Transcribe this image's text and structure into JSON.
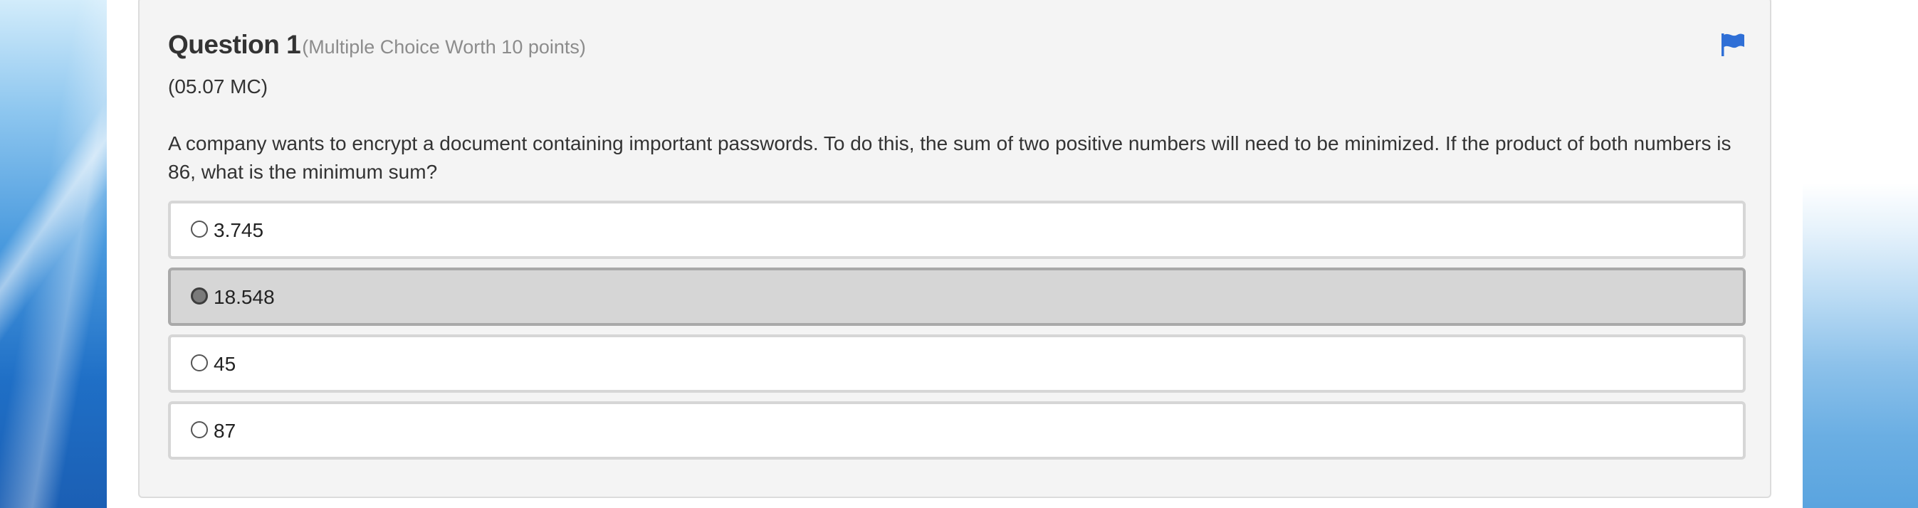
{
  "question": {
    "title": "Question 1",
    "meta": "(Multiple Choice Worth 10 points)",
    "code": "(05.07 MC)",
    "text": "A company wants to encrypt a document containing important passwords. To do this, the sum of two positive numbers will need to be minimized. If the product of both numbers is 86, what is the minimum sum?",
    "flag_icon": "flag-icon",
    "flag_color": "#2f6fd6"
  },
  "options": [
    {
      "label": "3.745",
      "selected": false
    },
    {
      "label": "18.548",
      "selected": true
    },
    {
      "label": "45",
      "selected": false
    },
    {
      "label": "87",
      "selected": false
    }
  ]
}
